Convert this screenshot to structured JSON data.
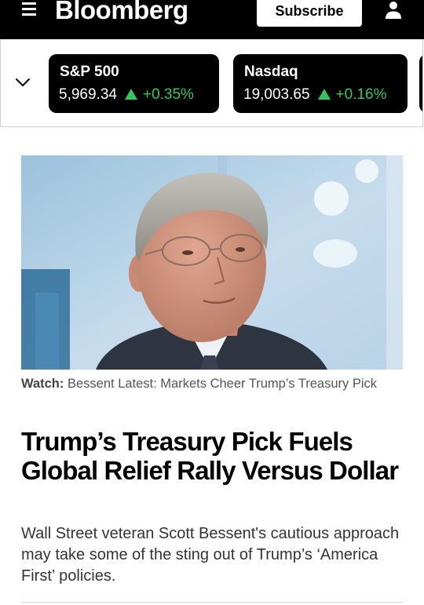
{
  "header": {
    "brand": "Bloomberg",
    "subscribe_label": "Subscribe",
    "menu_icon": "hamburger-menu-icon",
    "user_icon": "user-icon"
  },
  "tickers": [
    {
      "name": "S&P 500",
      "value": "5,969.34",
      "change": "+0.35%",
      "direction": "up"
    },
    {
      "name": "Nasdaq",
      "value": "19,003.65",
      "change": "+0.16%",
      "direction": "up"
    }
  ],
  "colors": {
    "header_bg": "#000000",
    "ticker_card_bg": "#000000",
    "positive": "#35c759"
  },
  "article": {
    "caption_label": "Watch:",
    "caption_text": "Bessent Latest: Markets Cheer Trump’s Treasury Pick",
    "headline": "Trump’s Treasury Pick Fuels Global Relief Rally Versus Dollar",
    "summary": "Wall Street veteran Scott Bessent's cautious approach may take some of the sting out of Trump’s ‘America First’ policies."
  }
}
